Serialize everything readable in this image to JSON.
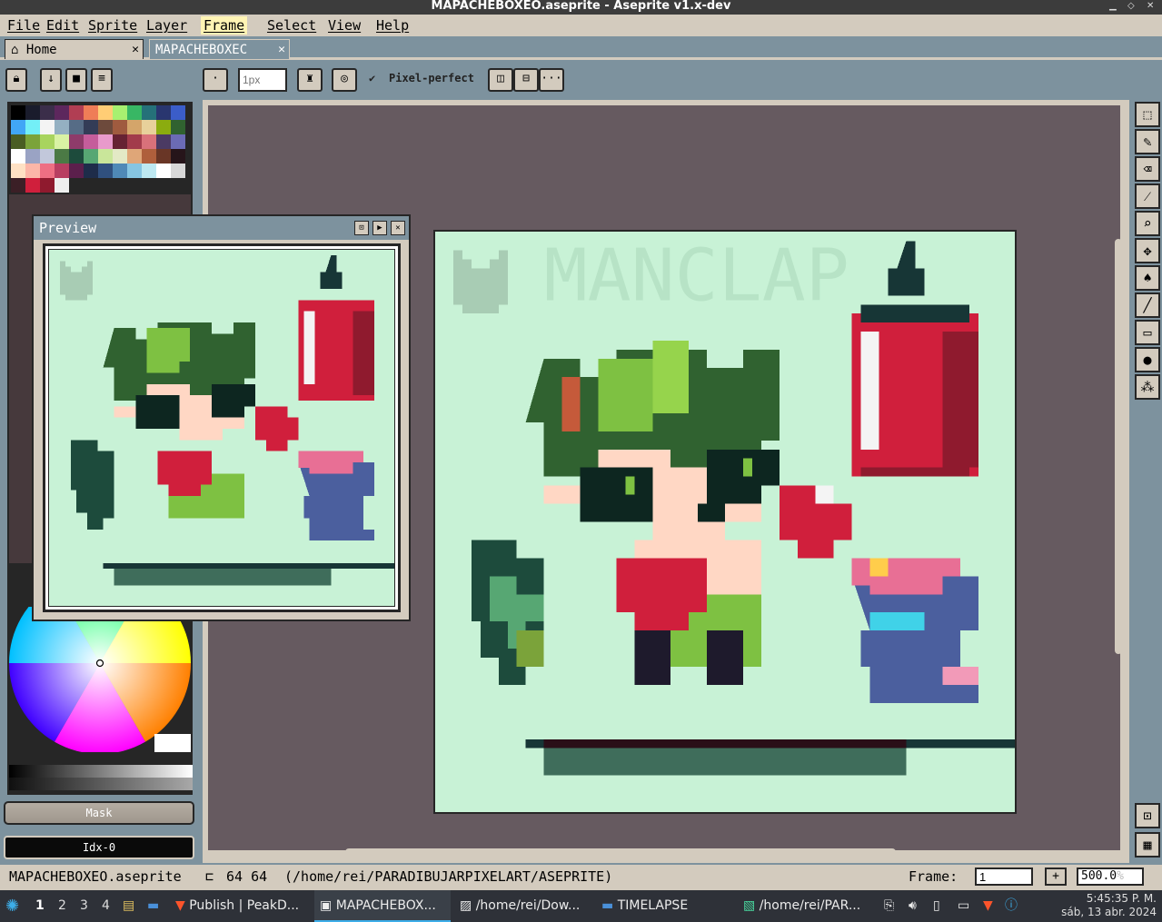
{
  "window": {
    "title": "MAPACHEBOXEO.aseprite - Aseprite v1.x-dev"
  },
  "menu": [
    "File",
    "Edit",
    "Sprite",
    "Layer",
    "Frame",
    "Select",
    "View",
    "Help"
  ],
  "tabs": [
    {
      "label": "Home",
      "icon": "home-icon"
    },
    {
      "label": "MAPACHEBOXEC",
      "icon": ""
    }
  ],
  "toolbar": {
    "brush_size_placeholder": "1px",
    "pixel_perfect_label": "Pixel-perfect",
    "more_label": "···"
  },
  "preview": {
    "title": "Preview"
  },
  "palette_colors": [
    "#000000",
    "#1a1c2c",
    "#3b2e4a",
    "#5d275d",
    "#b13e53",
    "#ef7d57",
    "#ffcd75",
    "#a7f070",
    "#38b764",
    "#257179",
    "#29366f",
    "#3b5dc9",
    "#41a6f6",
    "#73eff7",
    "#f4f4f4",
    "#94b0c2",
    "#566c86",
    "#333c57",
    "#6d4a3c",
    "#a05b3f",
    "#d4a56a",
    "#e8d19b",
    "#8bac0f",
    "#306230",
    "#4a5d23",
    "#7ba33a",
    "#a8d45e",
    "#d9f2a4",
    "#8e3b6a",
    "#c55d9b",
    "#e89acb",
    "#662233",
    "#a23b4b",
    "#d9717a",
    "#4b3a63",
    "#6b6bb5",
    "#ffffff",
    "#9aa3c4",
    "#c2c8db",
    "#4b7a45",
    "#1d4b3c",
    "#57a773",
    "#c9e69a",
    "#e3e9c5",
    "#dfa678",
    "#af5f3c",
    "#693626",
    "#26151a",
    "#ffe1c4",
    "#fcb6a8",
    "#ee6f83",
    "#b83e61",
    "#5b1f4c",
    "#1e2c4a",
    "#30507e",
    "#4f89b7",
    "#86c5e1",
    "#bde8f1",
    "#ffffff",
    "#d7d7d7",
    "#3b1f26",
    "#d01f3c",
    "#8f1a2e",
    "#efefef"
  ],
  "mask_label": "Mask",
  "index_label": "Idx-0",
  "status": {
    "filename": "MAPACHEBOXEO.aseprite",
    "size": "64 64",
    "path": "(/home/rei/PARADIBUJARPIXELART/ASEPRITE)",
    "frame_label": "Frame:",
    "frame_value": "1",
    "zoom_value": "500.0",
    "zoom_unit": "%"
  },
  "taskbar": {
    "desktops": [
      "1",
      "2",
      "3",
      "4"
    ],
    "tasks": [
      "Publish | PeakD...",
      "MAPACHEBOX...",
      "/home/rei/Dow...",
      "TIMELAPSE",
      "/home/rei/PAR..."
    ],
    "time": "5:45:35 P. M.",
    "date": "sáb, 13 abr. 2024"
  },
  "sprite_text": "MANCLAP"
}
